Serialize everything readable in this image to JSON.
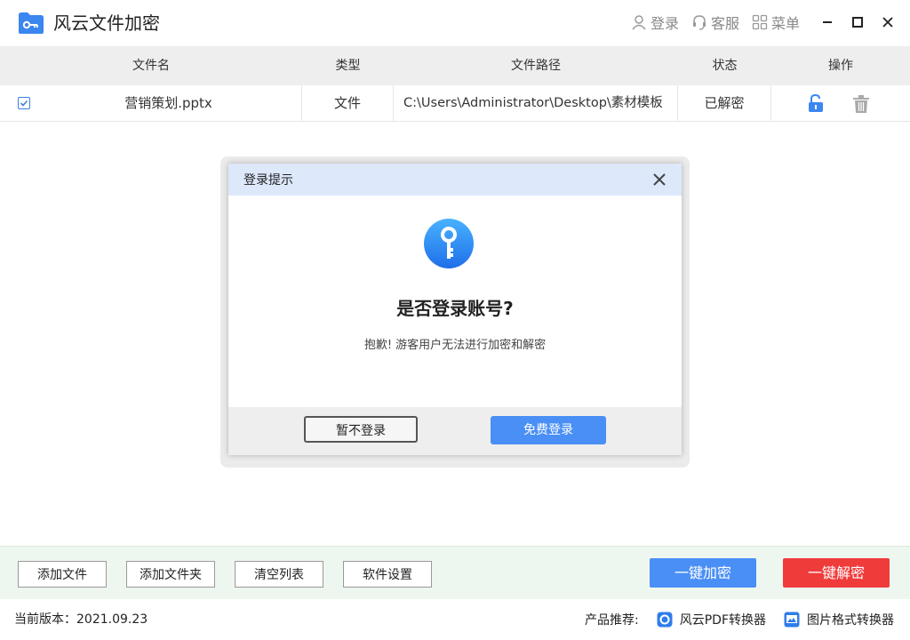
{
  "app": {
    "title": "风云文件加密"
  },
  "titlebar": {
    "login": "登录",
    "service": "客服",
    "menu": "菜单"
  },
  "table": {
    "headers": [
      "文件名",
      "类型",
      "文件路径",
      "状态",
      "操作"
    ],
    "rows": [
      {
        "checked": true,
        "name": "营销策划.pptx",
        "type": "文件",
        "path": "C:\\Users\\Administrator\\Desktop\\素材模板",
        "status": "已解密"
      }
    ]
  },
  "dialog": {
    "title": "登录提示",
    "question": "是否登录账号?",
    "message": "抱歉! 游客用户无法进行加密和解密",
    "later_label": "暂不登录",
    "login_label": "免费登录"
  },
  "toolbar": {
    "add_file": "添加文件",
    "add_folder": "添加文件夹",
    "clear_list": "清空列表",
    "settings": "软件设置",
    "encrypt_all": "一键加密",
    "decrypt_all": "一键解密"
  },
  "status": {
    "version": "当前版本：2021.09.23",
    "recommend_label": "产品推荐:",
    "products": [
      "风云PDF转换器",
      "图片格式转换器"
    ]
  },
  "colors": {
    "accent": "#4a8ff5",
    "danger": "#f03b3b",
    "header_bg": "#eeeeee",
    "dialog_header_bg": "#dde8fb"
  }
}
